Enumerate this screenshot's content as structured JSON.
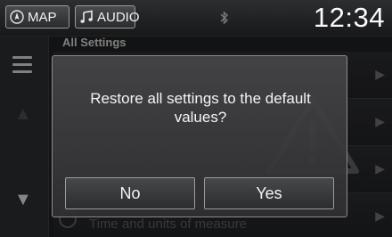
{
  "topbar": {
    "map_label": "MAP",
    "audio_label": "AUDIO",
    "time": "12:34"
  },
  "settings": {
    "title": "All Settings",
    "visible_row_label": "Time and units of measure"
  },
  "dialog": {
    "message": "Restore all settings to the default values?",
    "no_label": "No",
    "yes_label": "Yes"
  },
  "colors": {
    "background": "#1e1f21",
    "dialog_border": "#8c8c8c",
    "text": "#f4f4f4"
  },
  "icons": [
    "compass-icon",
    "music-note-icon",
    "bluetooth-icon",
    "menu-icon",
    "up-arrow-icon",
    "down-arrow-icon",
    "chevron-right-icon",
    "warning-icon"
  ]
}
